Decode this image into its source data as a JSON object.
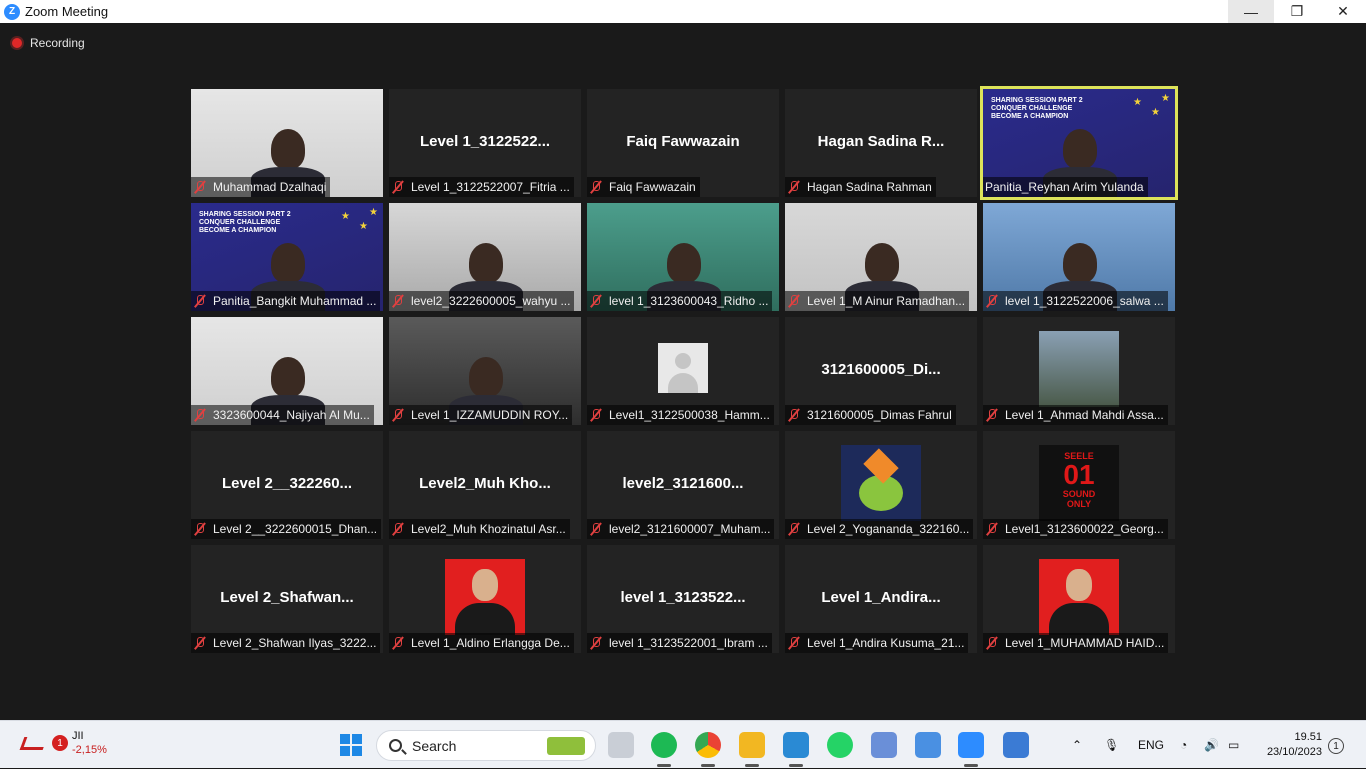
{
  "window": {
    "title": "Zoom Meeting",
    "controls": {
      "minimize": "—",
      "maximize": "❐",
      "close": "✕"
    }
  },
  "meeting": {
    "recording_label": "Recording",
    "participants": [
      {
        "display": "",
        "name": "Muhammad Dzalhaqi",
        "video": "white",
        "muted": true
      },
      {
        "display": "Level 1_3122522...",
        "name": "Level 1_3122522007_Fitria ...",
        "video": "none",
        "muted": true
      },
      {
        "display": "Faiq Fawwazain",
        "name": "Faiq Fawwazain",
        "video": "none",
        "muted": true
      },
      {
        "display": "Hagan Sadina R...",
        "name": "Hagan Sadina Rahman",
        "video": "none",
        "muted": true
      },
      {
        "display": "",
        "name": "Panitia_Reyhan Arim Yulanda",
        "video": "slide",
        "muted": false,
        "active_speaker": true
      },
      {
        "display": "",
        "name": "Panitia_Bangkit Muhammad ...",
        "video": "slide",
        "muted": true
      },
      {
        "display": "",
        "name": "level2_3222600005_wahyu ...",
        "video": "room",
        "muted": true
      },
      {
        "display": "",
        "name": "level 1_3123600043_Ridho ...",
        "video": "teal",
        "muted": true
      },
      {
        "display": "",
        "name": "Level 1_M Ainur Ramadhan...",
        "video": "grey",
        "muted": true
      },
      {
        "display": "",
        "name": "level 1_3122522006_salwa ...",
        "video": "blue",
        "muted": true
      },
      {
        "display": "",
        "name": "3323600044_Najiyah Al Mu...",
        "video": "white",
        "muted": true
      },
      {
        "display": "",
        "name": "Level 1_IZZAMUDDIN ROY...",
        "video": "dark",
        "muted": true
      },
      {
        "display": "",
        "name": "Level1_3122500038_Hamm...",
        "video": "none",
        "avatar": "grey",
        "muted": true
      },
      {
        "display": "3121600005_Di...",
        "name": "3121600005_Dimas Fahrul",
        "video": "none",
        "muted": true
      },
      {
        "display": "",
        "name": "Level 1_Ahmad Mahdi Assa...",
        "video": "none",
        "avatar": "photo",
        "muted": true
      },
      {
        "display": "Level 2__322260...",
        "name": "Level 2__3222600015_Dhan...",
        "video": "none",
        "muted": true
      },
      {
        "display": "Level2_Muh  Kho...",
        "name": "Level2_Muh Khozinatul Asr...",
        "video": "none",
        "muted": true
      },
      {
        "display": "level2_3121600...",
        "name": "level2_3121600007_Muham...",
        "video": "none",
        "muted": true
      },
      {
        "display": "",
        "name": "Level 2_Yogananda_322160...",
        "video": "none",
        "avatar": "game",
        "muted": true
      },
      {
        "display": "",
        "name": "Level1_3123600022_Georg...",
        "video": "none",
        "avatar": "seele",
        "muted": true
      },
      {
        "display": "Level  2_Shafwan...",
        "name": "Level 2_Shafwan Ilyas_3222...",
        "video": "none",
        "muted": true
      },
      {
        "display": "",
        "name": "Level 1_Aldino Erlangga De...",
        "video": "none",
        "avatar": "red",
        "muted": true
      },
      {
        "display": "level 1_3123522...",
        "name": "level 1_3123522001_Ibram ...",
        "video": "none",
        "muted": true
      },
      {
        "display": "Level 1_Andira...",
        "name": "Level 1_Andira Kusuma_21...",
        "video": "none",
        "muted": true
      },
      {
        "display": "",
        "name": "Level 1_MUHAMMAD HAID...",
        "video": "none",
        "avatar": "red",
        "muted": true
      }
    ],
    "slide_text": {
      "line1": "SHARING SESSION PART 2",
      "line2": "CONQUER CHALLENGE",
      "line3": "BECOME A CHAMPION"
    },
    "avatar_seele": {
      "top": "SEELE",
      "number": "01",
      "bottom1": "SOUND",
      "bottom2": "ONLY"
    }
  },
  "taskbar": {
    "stock": {
      "badge": "1",
      "name": "JII",
      "change": "-2,15%"
    },
    "search_label": "Search",
    "language": "ENG",
    "time": "19.51",
    "date": "23/10/2023",
    "notification_count": "1",
    "colors": {
      "accent": "#2D8CFF",
      "active_border": "#dde35a",
      "mute_red": "#e04040"
    }
  }
}
